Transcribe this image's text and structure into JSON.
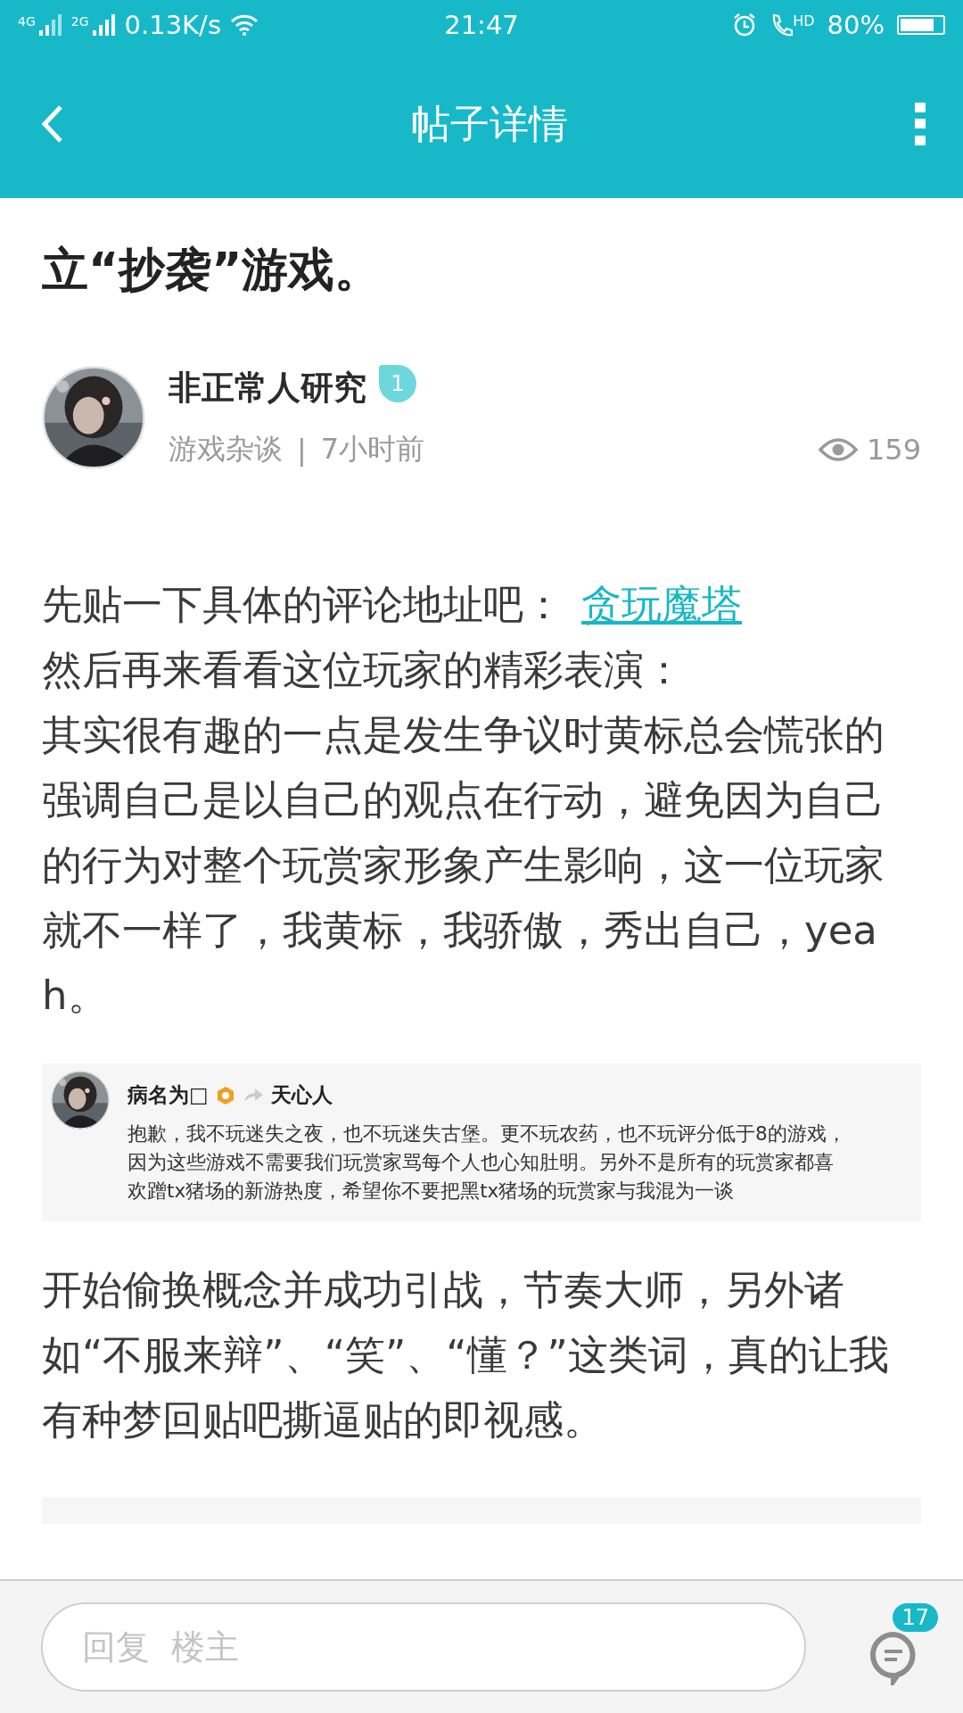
{
  "status_bar": {
    "network_1": "4G",
    "network_2": "2G",
    "speed": "0.13K/s",
    "time": "21:47",
    "call_label": "HD",
    "battery": "80%"
  },
  "header": {
    "title": "帖子详情"
  },
  "post": {
    "title_visible": "立“抄袭”游戏。",
    "author": {
      "name": "非正常人研究",
      "level": "1",
      "category": "游戏杂谈",
      "separator": "|",
      "time": "7小时前",
      "views": "159"
    },
    "paragraphs": [
      {
        "text": "先贴一下具体的评论地址吧：",
        "link": "贪玩魔塔"
      },
      {
        "text": "然后再来看看这位玩家的精彩表演："
      },
      {
        "text": "其实很有趣的一点是发生争议时黄标总会慌张的强调自己是以自己的观点在行动，避免因为自己的行为对整个玩赏家形象产生影响，这一位玩家就不一样了，我黄标，我骄傲，秀出自己，yeah。"
      }
    ],
    "quoted_comment": {
      "user": "病名为□",
      "reply_to": "天心人",
      "lines": [
        "抱歉，我不玩迷失之夜，也不玩迷失古堡。更不玩农药，也不玩评分低于8的游戏，",
        "因为这些游戏不需要我们玩赏家骂每个人也心知肚明。另外不是所有的玩赏家都喜",
        "欢蹭tx猪场的新游热度，希望你不要把黑tx猪场的玩赏家与我混为一谈"
      ]
    },
    "paragraphs_after": [
      {
        "text": "开始偷换概念并成功引战，节奏大师，另外诸如“不服来辩”、“笑”、“懂？”这类词，真的让我有种梦回贴吧撕逼贴的即视感。"
      }
    ]
  },
  "reply_bar": {
    "placeholder": "回复  楼主",
    "comment_count": "17"
  }
}
